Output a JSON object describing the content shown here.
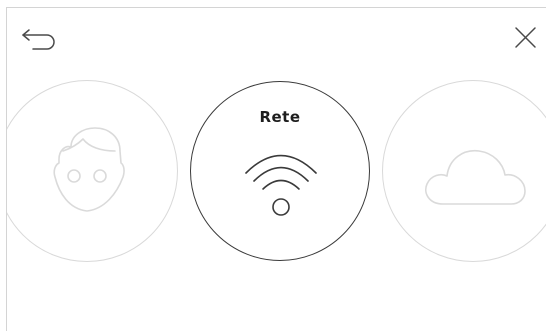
{
  "header": {
    "back_icon": "back-arrow-icon",
    "close_icon": "close-icon"
  },
  "carousel": {
    "items": [
      {
        "label": "",
        "icon": "user-face-icon",
        "state": "inactive"
      },
      {
        "label": "Rete",
        "icon": "wifi-icon",
        "state": "selected"
      },
      {
        "label": "",
        "icon": "cloud-icon",
        "state": "inactive"
      }
    ]
  },
  "colors": {
    "selected_stroke": "#3a3a3a",
    "inactive_stroke": "#d9d9d9",
    "title_text": "#1e1e1e",
    "background": "#ffffff"
  }
}
